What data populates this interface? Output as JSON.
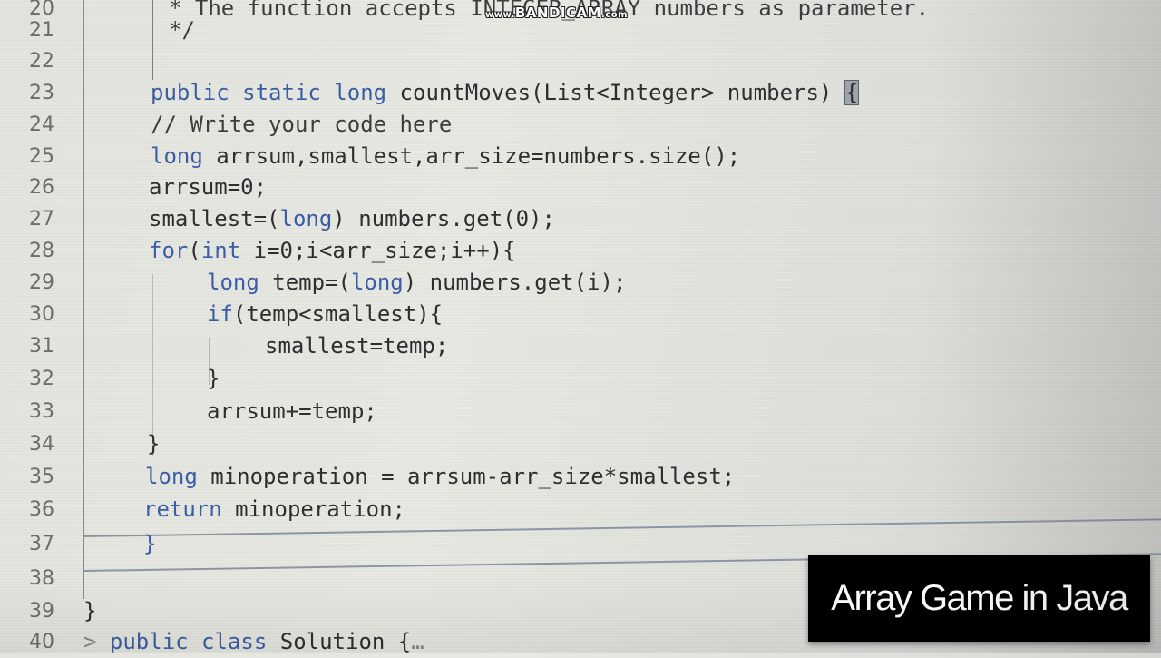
{
  "editor": {
    "language": "Java",
    "lines": [
      {
        "num": "20",
        "indent": 0,
        "tokens": [
          {
            "t": "* The function accepts INTEGER_ARRAY numbers as parameter.",
            "c": "cm"
          }
        ]
      },
      {
        "num": "21",
        "indent": 0,
        "tokens": [
          {
            "t": "*/",
            "c": "cm"
          }
        ]
      },
      {
        "num": "22",
        "indent": 0,
        "tokens": []
      },
      {
        "num": "23",
        "indent": 0,
        "tokens": [
          {
            "t": "public static long",
            "c": "kw"
          },
          {
            "t": " countMoves(List<Integer> numbers) ",
            "c": ""
          },
          {
            "t": "{",
            "c": "hl"
          }
        ]
      },
      {
        "num": "24",
        "indent": 0,
        "tokens": [
          {
            "t": "// Write your code here",
            "c": "cm"
          }
        ]
      },
      {
        "num": "25",
        "indent": 0,
        "tokens": [
          {
            "t": "long",
            "c": "kw"
          },
          {
            "t": " arrsum,smallest,arr_size=numbers.size();",
            "c": ""
          }
        ]
      },
      {
        "num": "26",
        "indent": 0,
        "tokens": [
          {
            "t": "arrsum=0;",
            "c": ""
          }
        ]
      },
      {
        "num": "27",
        "indent": 0,
        "tokens": [
          {
            "t": "smallest=(",
            "c": ""
          },
          {
            "t": "long",
            "c": "kw"
          },
          {
            "t": ") numbers.get(0);",
            "c": ""
          }
        ]
      },
      {
        "num": "28",
        "indent": 0,
        "tokens": [
          {
            "t": "for",
            "c": "kw"
          },
          {
            "t": "(",
            "c": ""
          },
          {
            "t": "int",
            "c": "kw"
          },
          {
            "t": " i=0;i<arr_size;i++){",
            "c": ""
          }
        ]
      },
      {
        "num": "29",
        "indent": 1,
        "tokens": [
          {
            "t": "long",
            "c": "kw"
          },
          {
            "t": " temp=(",
            "c": ""
          },
          {
            "t": "long",
            "c": "kw"
          },
          {
            "t": ") numbers.get(i);",
            "c": ""
          }
        ]
      },
      {
        "num": "30",
        "indent": 1,
        "tokens": [
          {
            "t": "if",
            "c": "kw"
          },
          {
            "t": "(temp<smallest){",
            "c": ""
          }
        ]
      },
      {
        "num": "31",
        "indent": 2,
        "tokens": [
          {
            "t": "smallest=temp;",
            "c": ""
          }
        ]
      },
      {
        "num": "32",
        "indent": 1,
        "tokens": [
          {
            "t": "}",
            "c": ""
          }
        ]
      },
      {
        "num": "33",
        "indent": 1,
        "tokens": [
          {
            "t": "arrsum+=temp;",
            "c": ""
          }
        ]
      },
      {
        "num": "34",
        "indent": 0,
        "tokens": [
          {
            "t": "}",
            "c": ""
          }
        ]
      },
      {
        "num": "35",
        "indent": 0,
        "tokens": [
          {
            "t": "long",
            "c": "kw"
          },
          {
            "t": " minoperation = arrsum-arr_size*smallest;",
            "c": ""
          }
        ]
      },
      {
        "num": "36",
        "indent": 0,
        "tokens": [
          {
            "t": "return",
            "c": "kw"
          },
          {
            "t": " minoperation;",
            "c": ""
          }
        ]
      },
      {
        "num": "37",
        "indent": 0,
        "tokens": [
          {
            "t": "}",
            "c": "kw"
          }
        ]
      },
      {
        "num": "38",
        "indent": 0,
        "tokens": []
      },
      {
        "num": "39",
        "indent": -1,
        "tokens": [
          {
            "t": "}",
            "c": ""
          }
        ]
      },
      {
        "num": "40",
        "indent": -1,
        "tokens": [
          {
            "t": "> ",
            "c": "fold"
          },
          {
            "t": "public class",
            "c": "kw"
          },
          {
            "t": " Solution {",
            "c": ""
          },
          {
            "t": "…",
            "c": "fold"
          }
        ]
      }
    ]
  },
  "watermark": {
    "prefix": "www.",
    "brand": "BANDICAM",
    "suffix": ".com"
  },
  "title_card": {
    "text": "Array Game in Java"
  },
  "colors": {
    "keyword": "#3b5fa6",
    "text": "#2e2f31",
    "line_number": "#6d6e6c",
    "title_bg": "#000000",
    "title_fg": "#ffffff"
  }
}
